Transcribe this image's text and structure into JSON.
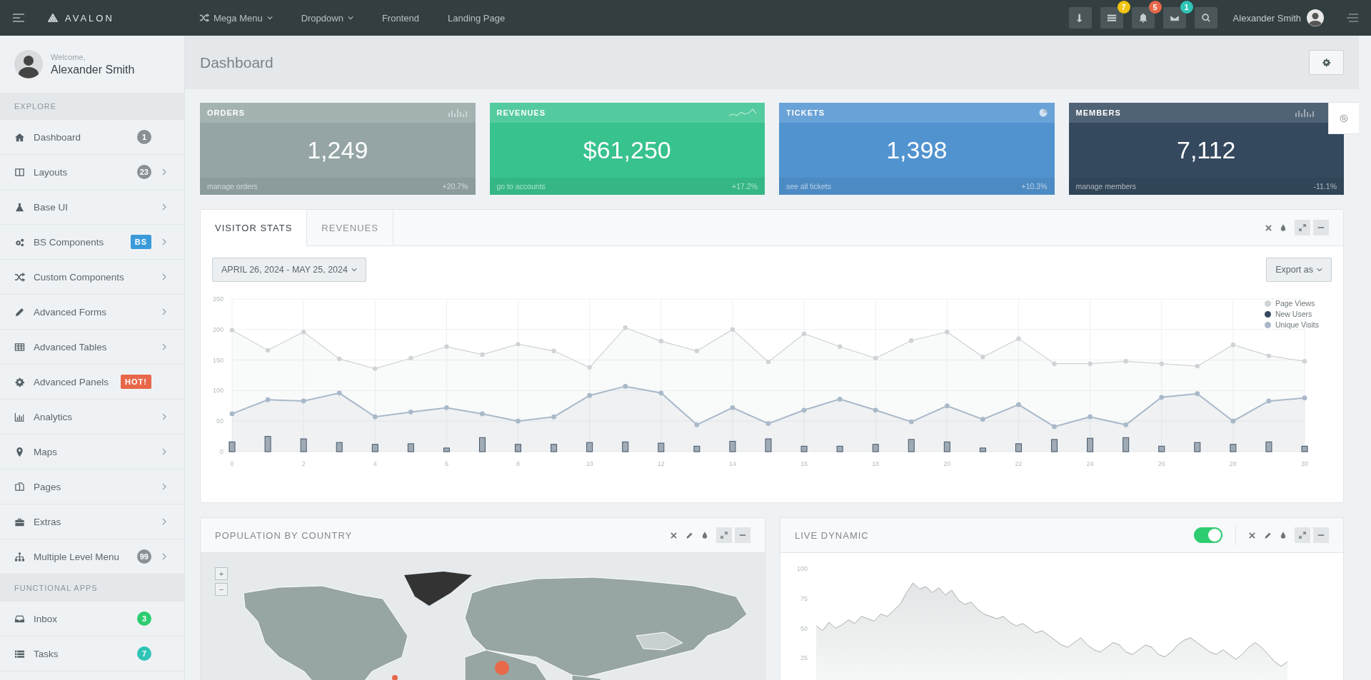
{
  "topbar": {
    "brand": "AVALON",
    "nav": [
      {
        "label": "Mega Menu",
        "dropdown": true
      },
      {
        "label": "Dropdown",
        "dropdown": true
      },
      {
        "label": "Frontend",
        "dropdown": false
      },
      {
        "label": "Landing Page",
        "dropdown": false
      }
    ],
    "actions": [
      {
        "kind": "download"
      },
      {
        "kind": "tasks",
        "badge": "7",
        "color": "#f1c40f"
      },
      {
        "kind": "alerts",
        "badge": "5",
        "color": "#e8674a"
      },
      {
        "kind": "messages",
        "badge": "1",
        "color": "#2ec4b6"
      },
      {
        "kind": "search"
      }
    ],
    "user": "Alexander Smith"
  },
  "sidebar": {
    "welcome": "Welcome,",
    "user": "Alexander Smith",
    "sections": [
      {
        "title": "EXPLORE",
        "items": [
          {
            "label": "Dashboard",
            "badge": {
              "text": "1",
              "kind": "pill",
              "color": "#8a8f94"
            },
            "submenu": false
          },
          {
            "label": "Layouts",
            "badge": {
              "text": "23",
              "kind": "pill",
              "color": "#8a8f94"
            },
            "submenu": true
          },
          {
            "label": "Base UI",
            "submenu": true
          },
          {
            "label": "BS Components",
            "badge": {
              "text": "BS",
              "kind": "label",
              "color": "#3a9ad9"
            },
            "submenu": true
          },
          {
            "label": "Custom Components",
            "submenu": true
          },
          {
            "label": "Advanced Forms",
            "submenu": true
          },
          {
            "label": "Advanced Tables",
            "submenu": true
          },
          {
            "label": "Advanced Panels",
            "badge": {
              "text": "HOT!",
              "kind": "label",
              "color": "#e8674a"
            },
            "submenu": false
          },
          {
            "label": "Analytics",
            "submenu": true
          },
          {
            "label": "Maps",
            "submenu": true
          },
          {
            "label": "Pages",
            "submenu": true
          },
          {
            "label": "Extras",
            "submenu": true
          },
          {
            "label": "Multiple Level Menu",
            "badge": {
              "text": "99",
              "kind": "pill",
              "color": "#8a8f94"
            },
            "submenu": true
          }
        ]
      },
      {
        "title": "FUNCTIONAL APPS",
        "items": [
          {
            "label": "Inbox",
            "badge": {
              "text": "3",
              "kind": "pill",
              "color": "#2ecc71"
            },
            "submenu": false
          },
          {
            "label": "Tasks",
            "badge": {
              "text": "7",
              "kind": "pill",
              "color": "#2ec4b6"
            },
            "submenu": false
          }
        ]
      }
    ]
  },
  "page": {
    "title": "Dashboard"
  },
  "cards": [
    {
      "title": "ORDERS",
      "value": "1,249",
      "link": "manage orders",
      "change": "+20.7%",
      "color": "#95a5a6"
    },
    {
      "title": "REVENUES",
      "value": "$61,250",
      "link": "go to accounts",
      "change": "+17.2%",
      "color": "#38c28e"
    },
    {
      "title": "TICKETS",
      "value": "1,398",
      "link": "see all tickets",
      "change": "+10.3%",
      "color": "#5193cf"
    },
    {
      "title": "MEMBERS",
      "value": "7,112",
      "link": "manage members",
      "change": "-11.1%",
      "color": "#34495e"
    }
  ],
  "visitor_panel": {
    "tabs": [
      {
        "label": "VISITOR STATS",
        "selected": true
      },
      {
        "label": "REVENUES",
        "selected": false
      }
    ],
    "date_range": "APRIL 26, 2024 - MAY 25, 2024",
    "export": "Export as",
    "chart_data": {
      "type": "area",
      "grid": true,
      "legend": true,
      "x": [
        0,
        1,
        2,
        3,
        4,
        5,
        6,
        7,
        8,
        9,
        10,
        11,
        12,
        13,
        14,
        15,
        16,
        17,
        18,
        19,
        20,
        21,
        22,
        23,
        24,
        25,
        26,
        27,
        28,
        29,
        30
      ],
      "xlim": [
        0,
        30
      ],
      "ylim": [
        0,
        250
      ],
      "xticks": [
        0,
        2,
        4,
        6,
        8,
        10,
        12,
        14,
        16,
        18,
        20,
        22,
        24,
        26,
        28,
        30
      ],
      "yticks": [
        0,
        50,
        100,
        150,
        200,
        250
      ],
      "series": [
        {
          "name": "Page Views",
          "color": "#cfd3d6",
          "type": "area",
          "marker": "circle",
          "values": [
            199,
            166,
            196,
            152,
            136,
            153,
            172,
            159,
            176,
            165,
            138,
            203,
            181,
            165,
            200,
            147,
            193,
            172,
            153,
            182,
            196,
            155,
            185,
            144,
            144,
            148,
            144,
            140,
            175,
            157,
            148
          ]
        },
        {
          "name": "New Users",
          "color": "#34495e",
          "type": "bar",
          "values": [
            16,
            25,
            21,
            15,
            12,
            13,
            6,
            23,
            12,
            12,
            15,
            16,
            14,
            9,
            17,
            21,
            9,
            9,
            12,
            20,
            16,
            6,
            13,
            20,
            22,
            23,
            9,
            15,
            12,
            16,
            9
          ]
        },
        {
          "name": "Unique Visits",
          "color": "#a9b9c9",
          "type": "area",
          "marker": "circle",
          "values": [
            62,
            85,
            83,
            96,
            57,
            65,
            72,
            62,
            50,
            57,
            92,
            107,
            96,
            44,
            72,
            46,
            68,
            86,
            68,
            49,
            75,
            53,
            77,
            41,
            57,
            44,
            89,
            95,
            50,
            83,
            88
          ]
        }
      ]
    }
  },
  "population_panel": {
    "title": "POPULATION BY COUNTRY",
    "zoom_in": "+",
    "zoom_out": "−"
  },
  "live_panel": {
    "title": "LIVE DYNAMIC",
    "toggle_on": true,
    "chart_data": {
      "type": "area",
      "ylim": [
        0,
        100
      ],
      "yticks": [
        25,
        50,
        75,
        100
      ],
      "series": [
        {
          "color": "#a7acaf",
          "values": [
            52,
            48,
            55,
            50,
            53,
            57,
            54,
            60,
            58,
            56,
            62,
            60,
            65,
            70,
            80,
            88,
            83,
            85,
            80,
            84,
            78,
            82,
            74,
            70,
            72,
            66,
            62,
            60,
            58,
            60,
            55,
            52,
            54,
            50,
            46,
            48,
            44,
            40,
            36,
            34,
            38,
            42,
            36,
            32,
            30,
            34,
            38,
            36,
            30,
            28,
            32,
            36,
            34,
            28,
            26,
            30,
            36,
            40,
            42,
            38,
            34,
            30,
            28,
            32,
            28,
            24,
            28,
            34,
            38,
            34,
            28,
            22,
            18,
            22
          ]
        }
      ]
    }
  }
}
